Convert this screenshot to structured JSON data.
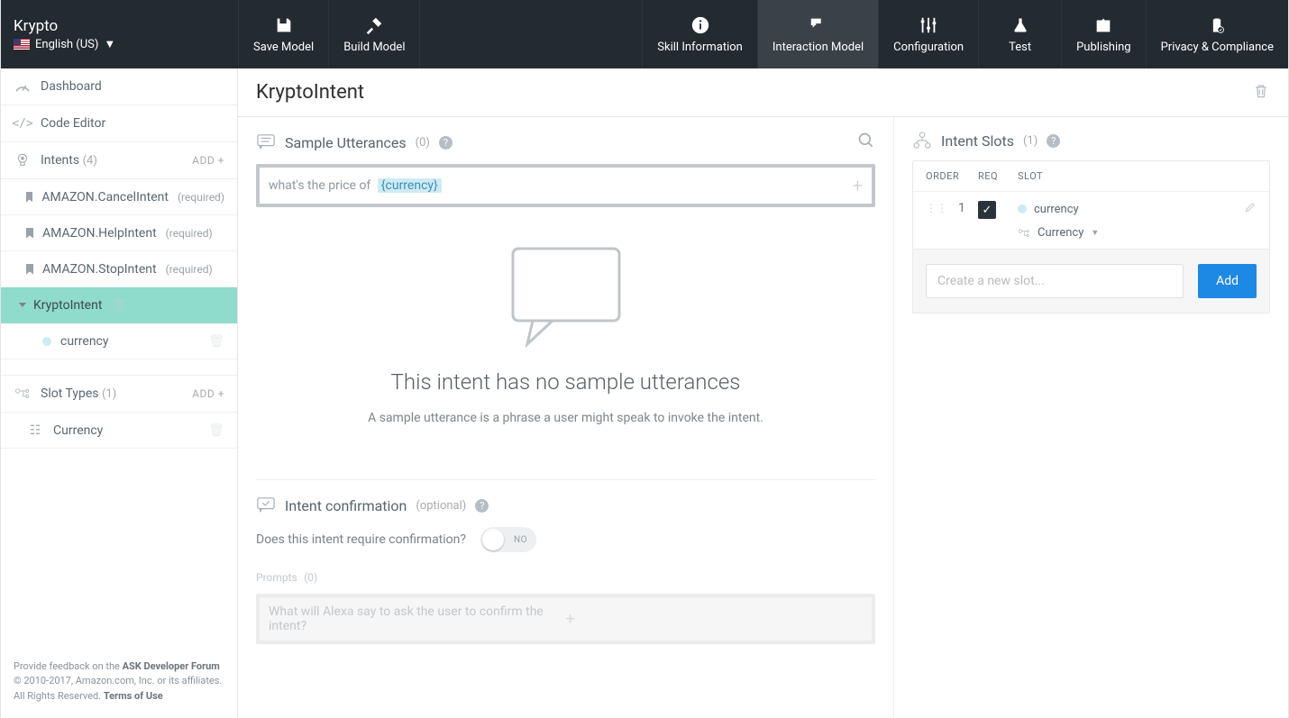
{
  "brand": {
    "name": "Krypto",
    "language": "English (US)"
  },
  "topnav": {
    "save": "Save Model",
    "build": "Build Model",
    "skill_info": "Skill Information",
    "interaction": "Interaction Model",
    "configuration": "Configuration",
    "test": "Test",
    "publishing": "Publishing",
    "privacy": "Privacy & Compliance"
  },
  "sidebar": {
    "dashboard": "Dashboard",
    "code_editor": "Code Editor",
    "intents_label": "Intents",
    "intents_count": "(4)",
    "add": "ADD",
    "intents": [
      {
        "name": "AMAZON.CancelIntent",
        "req": "(required)"
      },
      {
        "name": "AMAZON.HelpIntent",
        "req": "(required)"
      },
      {
        "name": "AMAZON.StopIntent",
        "req": "(required)"
      }
    ],
    "selected_intent": "KryptoIntent",
    "slot_under_intent": "currency",
    "slot_types_label": "Slot Types",
    "slot_types_count": "(1)",
    "slot_types": [
      {
        "name": "Currency"
      }
    ],
    "footer1a": "Provide feedback on the ",
    "footer1b": "ASK Developer Forum",
    "footer2": "© 2010-2017, Amazon.com, Inc. or its affiliates.",
    "footer3a": "All Rights Reserved. ",
    "footer3b": "Terms of Use"
  },
  "center": {
    "title": "KryptoIntent",
    "utt_title": "Sample Utterances",
    "utt_count": "(0)",
    "utt_prefix": "what's the price of ",
    "utt_slot": "{currency}",
    "empty_title": "This intent has no sample utterances",
    "empty_sub": "A sample utterance is a phrase a user might speak to invoke the intent.",
    "conf_title": "Intent confirmation",
    "conf_optional": "(optional)",
    "conf_q": "Does this intent require confirmation?",
    "toggle": "NO",
    "prompts_label": "Prompts",
    "prompts_count": "(0)",
    "prompt_placeholder": "What will Alexa say to ask the user to confirm the intent?"
  },
  "right": {
    "title": "Intent Slots",
    "count": "(1)",
    "th_order": "ORDER",
    "th_req": "REQ",
    "th_slot": "SLOT",
    "row": {
      "order": "1",
      "name": "currency",
      "type": "Currency"
    },
    "new_slot_placeholder": "Create a new slot...",
    "add_btn": "Add"
  }
}
